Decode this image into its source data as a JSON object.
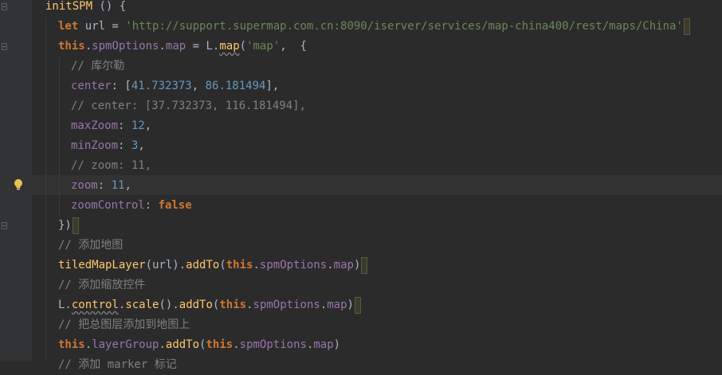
{
  "lines": [
    [
      {
        "t": "initSPM",
        "c": "fn"
      },
      {
        "t": " () {",
        "c": "plain"
      }
    ],
    [
      {
        "t": "let ",
        "c": "kw"
      },
      {
        "t": "url = ",
        "c": "plain"
      },
      {
        "t": "'http://support.supermap.com.cn:8090/iserver/services/map-china400/rest/maps/China'",
        "c": "str"
      }
    ],
    [
      {
        "t": "this",
        "c": "kw"
      },
      {
        "t": ".",
        "c": "plain"
      },
      {
        "t": "spmOptions",
        "c": "prop"
      },
      {
        "t": ".",
        "c": "plain"
      },
      {
        "t": "map",
        "c": "prop"
      },
      {
        "t": " = L.",
        "c": "plain"
      },
      {
        "t": "map",
        "c": "fn"
      },
      {
        "t": "(",
        "c": "plain"
      },
      {
        "t": "'map'",
        "c": "str"
      },
      {
        "t": ",  {",
        "c": "plain"
      }
    ],
    [
      {
        "t": "// 库尔勒",
        "c": "cmt"
      }
    ],
    [
      {
        "t": "center",
        "c": "prop"
      },
      {
        "t": ": [",
        "c": "plain"
      },
      {
        "t": "41.732373",
        "c": "num"
      },
      {
        "t": ", ",
        "c": "plain"
      },
      {
        "t": "86.181494",
        "c": "num"
      },
      {
        "t": "],",
        "c": "plain"
      }
    ],
    [
      {
        "t": "// center: [37.732373, 116.181494],",
        "c": "cmt"
      }
    ],
    [
      {
        "t": "maxZoom",
        "c": "prop"
      },
      {
        "t": ": ",
        "c": "plain"
      },
      {
        "t": "12",
        "c": "num"
      },
      {
        "t": ",",
        "c": "plain"
      }
    ],
    [
      {
        "t": "minZoom",
        "c": "prop"
      },
      {
        "t": ": ",
        "c": "plain"
      },
      {
        "t": "3",
        "c": "num"
      },
      {
        "t": ",",
        "c": "plain"
      }
    ],
    [
      {
        "t": "// zoom: 11,",
        "c": "cmt"
      }
    ],
    [
      {
        "t": "zoom",
        "c": "prop"
      },
      {
        "t": ": ",
        "c": "plain"
      },
      {
        "t": "11",
        "c": "num"
      },
      {
        "t": ",",
        "c": "plain"
      }
    ],
    [
      {
        "t": "zoomControl",
        "c": "prop"
      },
      {
        "t": ": ",
        "c": "plain"
      },
      {
        "t": "false",
        "c": "kw"
      }
    ],
    [
      {
        "t": "})",
        "c": "plain"
      }
    ],
    [
      {
        "t": "// 添加地图",
        "c": "cmt"
      }
    ],
    [
      {
        "t": "tiledMapLayer",
        "c": "fn"
      },
      {
        "t": "(url).",
        "c": "plain"
      },
      {
        "t": "addTo",
        "c": "fn"
      },
      {
        "t": "(",
        "c": "plain"
      },
      {
        "t": "this",
        "c": "kw"
      },
      {
        "t": ".",
        "c": "plain"
      },
      {
        "t": "spmOptions",
        "c": "prop"
      },
      {
        "t": ".",
        "c": "plain"
      },
      {
        "t": "map",
        "c": "prop"
      },
      {
        "t": ")",
        "c": "plain"
      }
    ],
    [
      {
        "t": "// 添加缩放控件",
        "c": "cmt"
      }
    ],
    [
      {
        "t": "L.",
        "c": "plain"
      },
      {
        "t": "control",
        "c": "fn"
      },
      {
        "t": ".",
        "c": "plain"
      },
      {
        "t": "scale",
        "c": "fn"
      },
      {
        "t": "().",
        "c": "plain"
      },
      {
        "t": "addTo",
        "c": "fn"
      },
      {
        "t": "(",
        "c": "plain"
      },
      {
        "t": "this",
        "c": "kw"
      },
      {
        "t": ".",
        "c": "plain"
      },
      {
        "t": "spmOptions",
        "c": "prop"
      },
      {
        "t": ".",
        "c": "plain"
      },
      {
        "t": "map",
        "c": "prop"
      },
      {
        "t": ")",
        "c": "plain"
      }
    ],
    [
      {
        "t": "// 把总图层添加到地图上",
        "c": "cmt"
      }
    ],
    [
      {
        "t": "this",
        "c": "kw"
      },
      {
        "t": ".",
        "c": "plain"
      },
      {
        "t": "layerGroup",
        "c": "prop"
      },
      {
        "t": ".",
        "c": "plain"
      },
      {
        "t": "addTo",
        "c": "fn"
      },
      {
        "t": "(",
        "c": "plain"
      },
      {
        "t": "this",
        "c": "kw"
      },
      {
        "t": ".",
        "c": "plain"
      },
      {
        "t": "spmOptions",
        "c": "prop"
      },
      {
        "t": ".",
        "c": "plain"
      },
      {
        "t": "map",
        "c": "prop"
      },
      {
        "t": ")",
        "c": "plain"
      }
    ],
    [
      {
        "t": "// 添加 marker 标记",
        "c": "cmt"
      }
    ]
  ],
  "colors": {
    "background": "#2b2b2b",
    "gutter": "#313335",
    "keyword": "#cc7832",
    "function": "#ffc66d",
    "property": "#9876aa",
    "string": "#6a8759",
    "number": "#6897bb",
    "comment": "#808080",
    "text": "#a9b7c6"
  },
  "icons": {
    "gutter": "lightbulb-icon"
  }
}
